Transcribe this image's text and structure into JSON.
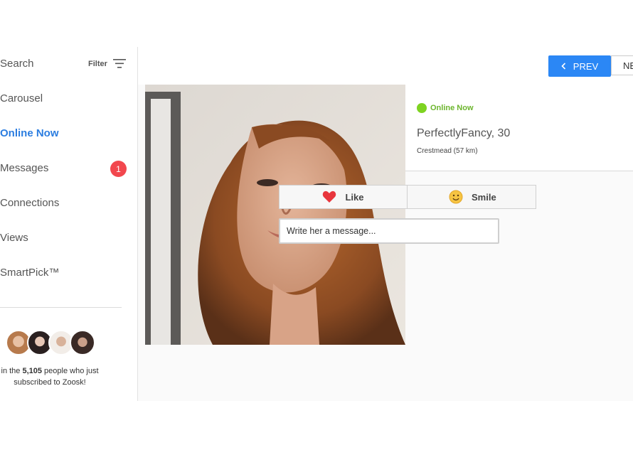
{
  "sidebar": {
    "search_label": "Search",
    "filter_label": "Filter",
    "items": [
      {
        "label": "Carousel"
      },
      {
        "label": "Online Now"
      },
      {
        "label": "Messages"
      },
      {
        "label": "Connections"
      },
      {
        "label": "Views"
      },
      {
        "label": "SmartPick™"
      }
    ],
    "messages_badge": "1",
    "promo": {
      "pre": "in the ",
      "count": "5,105",
      "post": " people who just subscribed to Zoosk!"
    }
  },
  "topbar": {
    "prev_label": "PREV",
    "next_label": "NE"
  },
  "profile": {
    "status": "Online Now",
    "name": "PerfectlyFancy, 30",
    "location": "Crestmead (57 km)"
  },
  "actions": {
    "like_label": "Like",
    "smile_label": "Smile"
  },
  "message": {
    "placeholder": "Write her a message..."
  },
  "colors": {
    "accent": "#2b87f5",
    "active_nav": "#2b7de0",
    "online": "#7ed321",
    "badge": "#f2474e"
  }
}
